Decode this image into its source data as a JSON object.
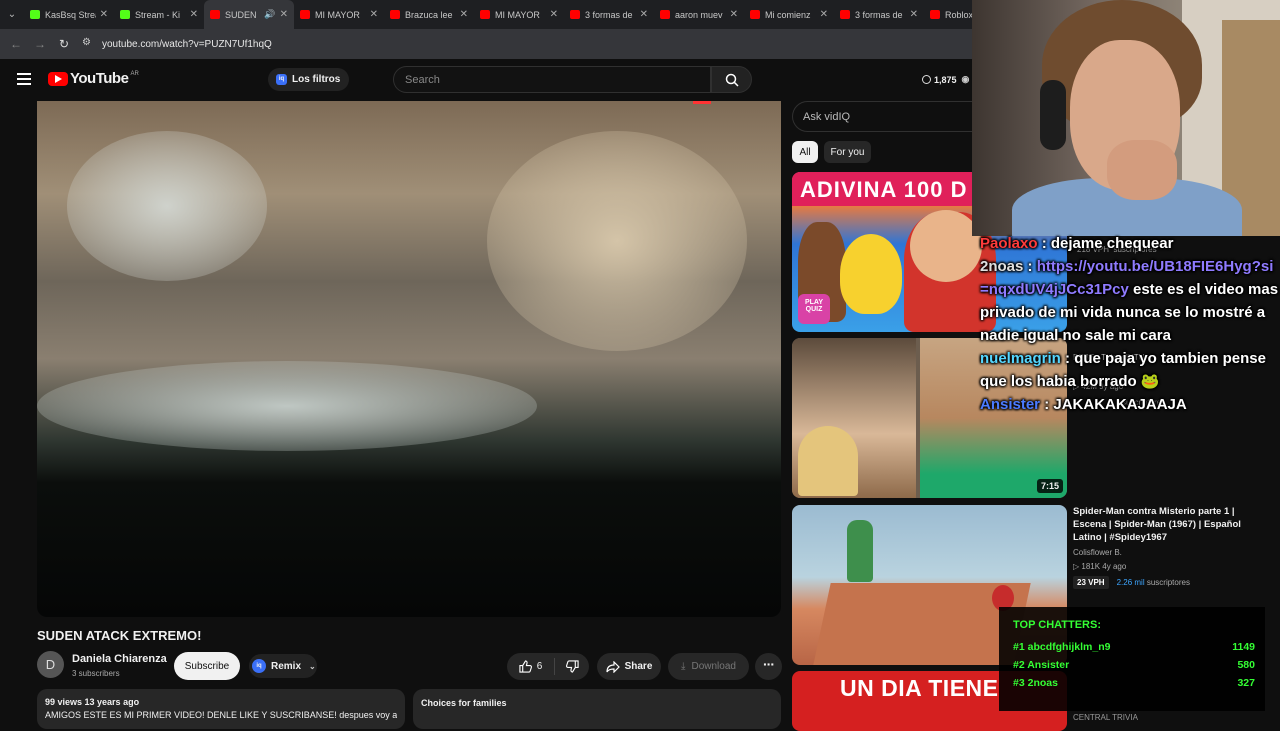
{
  "browser": {
    "tabs": [
      {
        "title": "KasBsq Strea",
        "favicon": "kick-icon",
        "active": false
      },
      {
        "title": "Stream - Ki",
        "favicon": "kick-icon",
        "active": false
      },
      {
        "title": "SUDEN",
        "favicon": "youtube-icon",
        "active": true,
        "audio": true
      },
      {
        "title": "MI MAYOR",
        "favicon": "youtube-icon",
        "active": false
      },
      {
        "title": "Brazuca lee",
        "favicon": "youtube-icon",
        "active": false
      },
      {
        "title": "MI MAYOR",
        "favicon": "youtube-icon",
        "active": false
      },
      {
        "title": "3 formas de",
        "favicon": "youtube-icon",
        "active": false
      },
      {
        "title": "aaron muev",
        "favicon": "youtube-icon",
        "active": false
      },
      {
        "title": "Mi comienz",
        "favicon": "youtube-icon",
        "active": false
      },
      {
        "title": "3 formas de",
        "favicon": "youtube-icon",
        "active": false
      },
      {
        "title": "Roblox",
        "favicon": "youtube-icon",
        "active": false
      }
    ],
    "url": "youtube.com/watch?v=PUZN7Uf1hqQ"
  },
  "header": {
    "logo_text": "YouTube",
    "country_code": "AR",
    "filters_label": "Los filtros",
    "filters_icon": "iq",
    "search_placeholder": "Search",
    "watch_count": "1,875"
  },
  "video": {
    "title": "SUDEN ATACK EXTREMO!",
    "channel_initial": "D",
    "channel_name": "Daniela Chiarenza",
    "subscribers": "3 subscribers",
    "subscribe_label": "Subscribe",
    "remix_label": "Remix",
    "likes": "6",
    "share_label": "Share",
    "download_label": "Download",
    "views_age": "99 views  13 years ago",
    "description": "AMIGOS ESTE ES MI PRIMER VIDEO! DENLE LIKE Y SUSCRIBANSE! despues voy a",
    "families_label": "Choices for families"
  },
  "sidebar": {
    "ask_placeholder": "Ask vidIQ",
    "chips": [
      "All",
      "For you"
    ],
    "recommendations": [
      {
        "thumb_text": "ADIVINA 100 D",
        "badge": "PLAY QUIZ",
        "vph": "218 VPH",
        "subs": "suscriptores"
      },
      {
        "channel": "BEBE - ThiagoIUTU",
        "views": "42M  9y ago",
        "subs": "suscriptores",
        "duration": "7:15"
      },
      {
        "title": "Spider-Man contra Misterio parte 1 | Escena | Spider-Man (1967) | Español Latino | #Spidey1967",
        "channel": "Colisflower B.",
        "views": "181K  4y ago",
        "vph": "23 VPH",
        "subs_num": "2.26 mil",
        "subs_label": "suscriptores"
      },
      {
        "thumb_text": "UN DIA TIENE",
        "channel": "CENTRAL TRIVIA"
      }
    ]
  },
  "overlay": {
    "chat": [
      {
        "user": "Paolaxo",
        "user_color": "#ff3b3b",
        "sep": " : ",
        "message": "dejame chequear"
      },
      {
        "user": "2noas",
        "user_color": "#e0e0e0",
        "sep": " : ",
        "link": "https://youtu.be/UB18FIE6Hyg?si=nqxdUV4jJCc31Pcy",
        "message": " este es el video mas privado de mi vida nunca se lo mostré a nadie igual no sale mi cara"
      },
      {
        "user": "nuelmagrin",
        "user_color": "#55d7ff",
        "sep": " : ",
        "message": "que paja yo tambien pense que los habia borrado 🐸"
      },
      {
        "user": "Ansister",
        "user_color": "#4b7bff",
        "sep": " : ",
        "message": "JAKAKAKAJAAJA"
      }
    ],
    "top_chatters_title": "TOP CHATTERS:",
    "top_chatters": [
      {
        "rank": "#1",
        "name": "abcdfghijklm_n9",
        "count": "1149"
      },
      {
        "rank": "#2",
        "name": "Ansister",
        "count": "580"
      },
      {
        "rank": "#3",
        "name": "2noas",
        "count": "327"
      }
    ],
    "accent_color": "#34ff34"
  }
}
